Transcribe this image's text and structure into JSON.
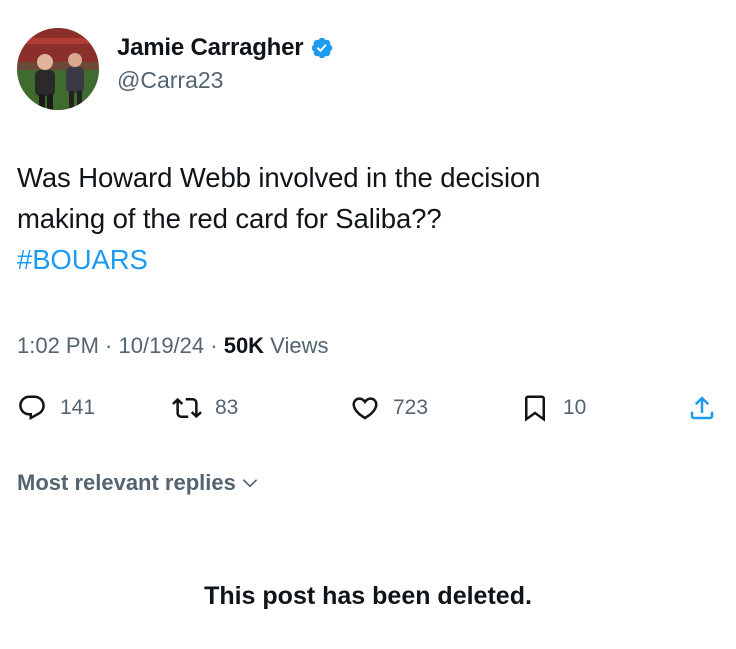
{
  "tweet": {
    "author": {
      "display_name": "Jamie Carragher",
      "handle": "@Carra23",
      "verified": true,
      "verified_color": "#1d9bf0"
    },
    "text_line_1": "Was Howard Webb involved in the decision",
    "text_line_2": "making of the red card for Saliba??",
    "hashtag": "#BOUARS",
    "meta": {
      "time": "1:02 PM",
      "separator_1": " · ",
      "date": "10/19/24",
      "separator_2": " · ",
      "views_count": "50K",
      "views_label": " Views"
    },
    "actions": {
      "reply": {
        "icon": "reply-icon",
        "count": "141"
      },
      "repost": {
        "icon": "repost-icon",
        "count": "83"
      },
      "like": {
        "icon": "heart-icon",
        "count": "723"
      },
      "bookmark": {
        "icon": "bookmark-icon",
        "count": "10"
      },
      "share": {
        "icon": "share-icon"
      }
    }
  },
  "replies": {
    "sort_label": "Most relevant replies"
  },
  "status_message": "This post has been deleted.",
  "colors": {
    "text": "#0f1419",
    "secondary": "#536471",
    "link": "#1d9bf0",
    "background": "#ffffff"
  }
}
